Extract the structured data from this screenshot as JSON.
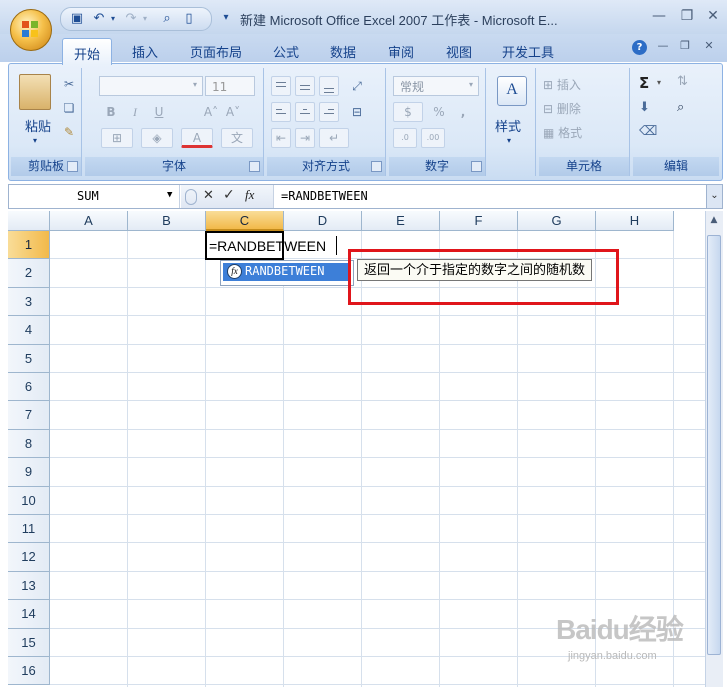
{
  "window": {
    "title": "新建 Microsoft Office Excel 2007 工作表 - Microsoft E..."
  },
  "ribbon_tabs": [
    "开始",
    "插入",
    "页面布局",
    "公式",
    "数据",
    "审阅",
    "视图",
    "开发工具"
  ],
  "ribbon": {
    "clipboard": {
      "label": "剪贴板",
      "paste": "粘贴"
    },
    "font": {
      "label": "字体",
      "size": "11",
      "bold": "B",
      "italic": "I",
      "underline": "U",
      "font_color_glyph": "A"
    },
    "alignment": {
      "label": "对齐方式"
    },
    "number": {
      "label": "数字",
      "format": "常规",
      "percent": "%",
      "comma": ","
    },
    "styles": {
      "label": "样式"
    },
    "cells": {
      "label": "单元格",
      "insert": "插入",
      "delete": "删除",
      "format": "格式"
    },
    "editing": {
      "label": "编辑",
      "sum_glyph": "Σ"
    }
  },
  "formula_bar": {
    "name_box": "SUM",
    "fx_glyph": "fx",
    "content": "=RANDBETWEEN"
  },
  "grid": {
    "columns": [
      "A",
      "B",
      "C",
      "D",
      "E",
      "F",
      "G",
      "H"
    ],
    "rows": [
      "1",
      "2",
      "3",
      "4",
      "5",
      "6",
      "7",
      "8",
      "9",
      "10",
      "11",
      "12",
      "13",
      "14",
      "15",
      "16"
    ],
    "active_cell_text": "=RANDBETWEEN"
  },
  "autocomplete": {
    "icon_glyph": "fx",
    "item": "RANDBETWEEN",
    "tooltip": "返回一个介于指定的数字之间的随机数"
  },
  "watermark": {
    "brand": "Baidu经验",
    "url": "jingyan.baidu.com"
  },
  "colors": {
    "accent": "#15428b",
    "highlight_box": "#e0151b",
    "selection": "#3d7fd8"
  }
}
